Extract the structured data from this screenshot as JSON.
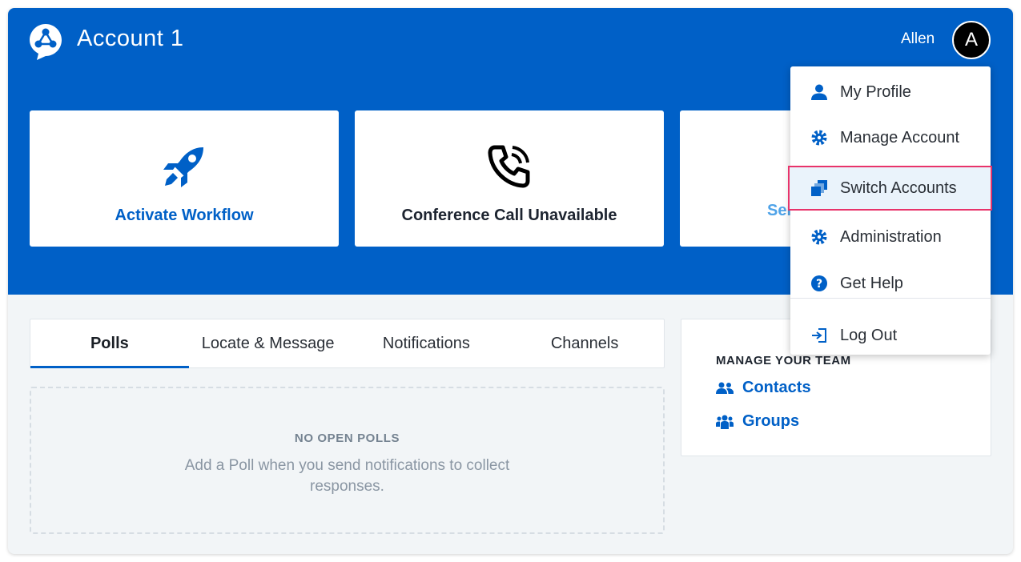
{
  "header": {
    "title": "Account 1",
    "user_name": "Allen",
    "avatar_initial": "A"
  },
  "cards": [
    {
      "label": "Activate Workflow",
      "icon": "rocket-icon"
    },
    {
      "label": "Conference Call Unavailable",
      "icon": "phone-icon"
    },
    {
      "label": "Ser",
      "icon": ""
    }
  ],
  "tabs": [
    {
      "label": "Polls",
      "active": true
    },
    {
      "label": "Locate & Message",
      "active": false
    },
    {
      "label": "Notifications",
      "active": false
    },
    {
      "label": "Channels",
      "active": false
    }
  ],
  "polls": {
    "empty_title": "NO OPEN POLLS",
    "empty_text": "Add a Poll when you send notifications to collect responses."
  },
  "team": {
    "title": "MANAGE YOUR TEAM",
    "links": [
      {
        "label": "Contacts",
        "icon": "contacts-icon"
      },
      {
        "label": "Groups",
        "icon": "groups-icon"
      }
    ]
  },
  "user_menu": {
    "items": [
      {
        "label": "My Profile",
        "icon": "person-icon"
      },
      {
        "label": "Manage Account",
        "icon": "gear-icon"
      },
      {
        "label": "Switch Accounts",
        "icon": "switch-accounts-icon",
        "highlighted": true
      },
      {
        "label": "Administration",
        "icon": "gear-icon"
      },
      {
        "label": "Get Help",
        "icon": "help-icon"
      },
      {
        "label": "Log Out",
        "icon": "logout-icon"
      }
    ]
  },
  "colors": {
    "brand_blue": "#0060c7",
    "highlight_border": "#e8336a",
    "highlight_bg": "#eaf3fb"
  }
}
